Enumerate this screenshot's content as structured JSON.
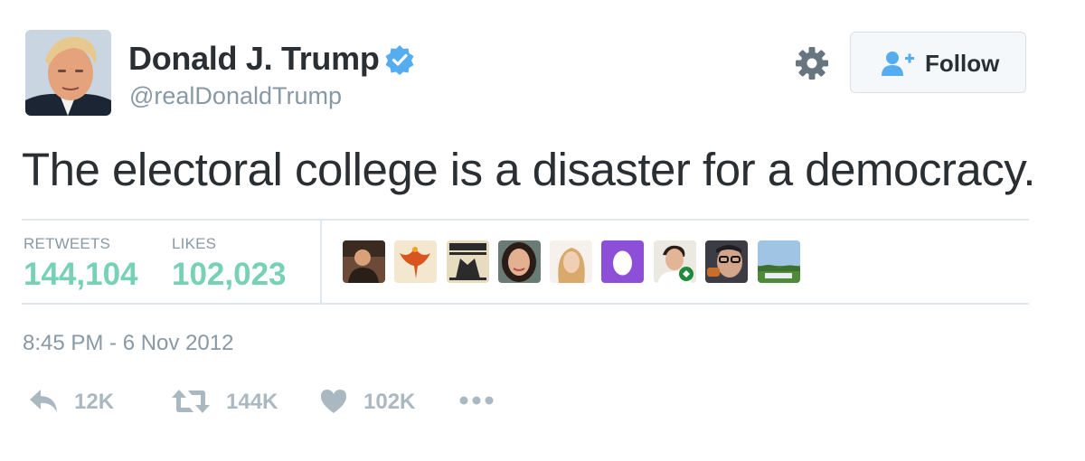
{
  "user": {
    "display_name": "Donald J. Trump",
    "handle": "@realDonaldTrump",
    "verified": true,
    "avatar_icon": "profile-photo"
  },
  "follow_button": {
    "label": "Follow",
    "icon": "add-user-icon"
  },
  "settings_icon": "gear-icon",
  "tweet": {
    "text": "The electoral college is a disaster for a democracy."
  },
  "stats": {
    "retweets_label": "RETWEETS",
    "retweets_value": "144,104",
    "likes_label": "LIKES",
    "likes_value": "102,023"
  },
  "likers": [
    {
      "icon": "avatar-person"
    },
    {
      "icon": "avatar-phoenix"
    },
    {
      "icon": "avatar-wanted-poster"
    },
    {
      "icon": "avatar-woman"
    },
    {
      "icon": "avatar-woman-blonde"
    },
    {
      "icon": "avatar-default-egg"
    },
    {
      "icon": "avatar-man-badge"
    },
    {
      "icon": "avatar-man-glasses"
    },
    {
      "icon": "avatar-landscape"
    }
  ],
  "timestamp": "8:45 PM - 6 Nov 2012",
  "actions": {
    "reply_count": "12K",
    "retweet_count": "144K",
    "like_count": "102K"
  },
  "colors": {
    "text": "#292f33",
    "muted": "#8899a6",
    "stat_green": "#77d1b6",
    "verified_blue": "#55acee",
    "action_gray": "#aab8c2",
    "divider": "#e1e8ed"
  }
}
